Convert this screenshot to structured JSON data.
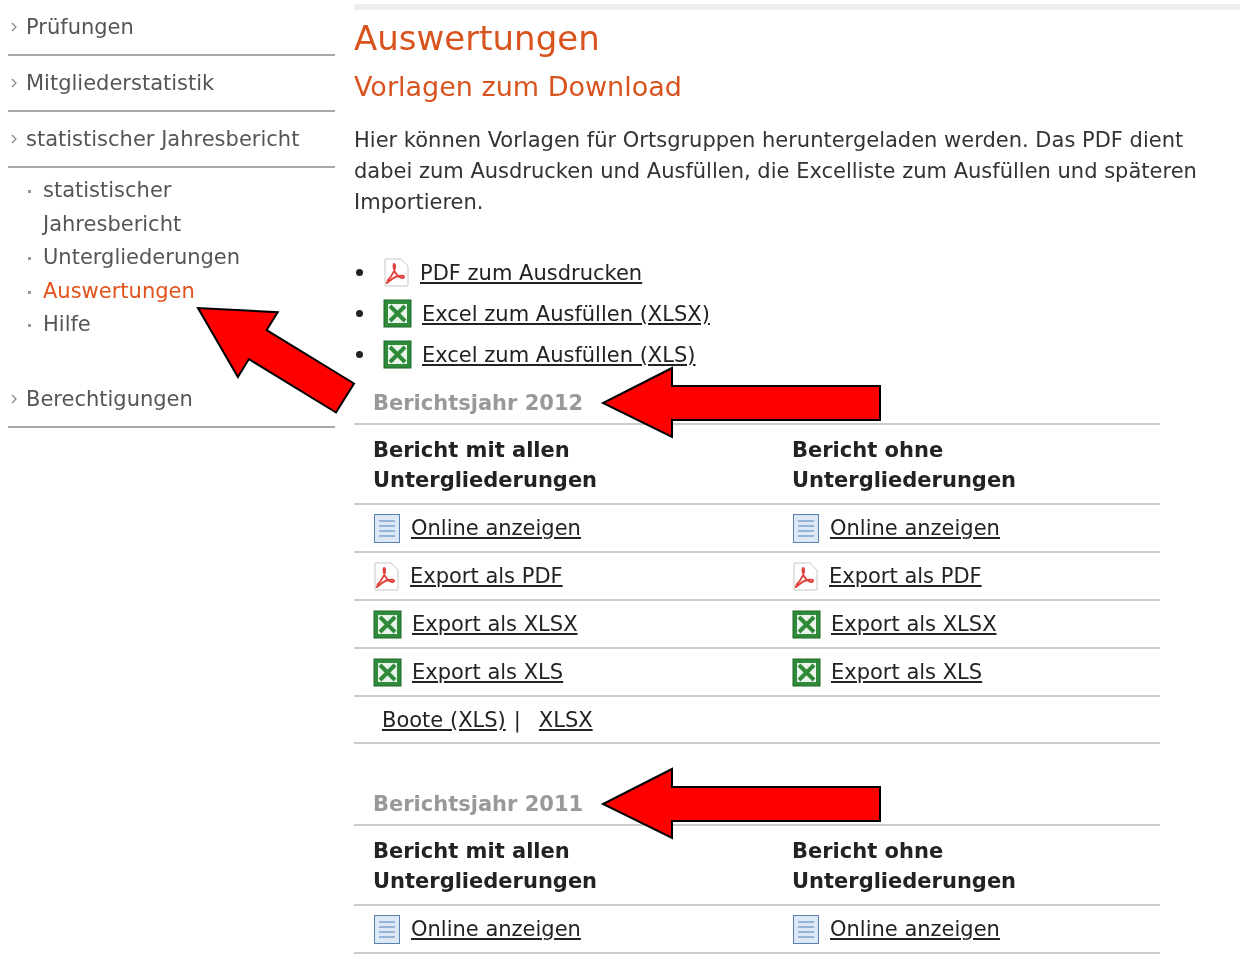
{
  "sidebar": {
    "items": [
      {
        "label": "Prüfungen"
      },
      {
        "label": "Mitgliederstatistik"
      },
      {
        "label": "statistischer Jahresbericht",
        "children": [
          {
            "label": "statistischer Jahresbericht",
            "selected": false
          },
          {
            "label": "Untergliederungen",
            "selected": false
          },
          {
            "label": "Auswertungen",
            "selected": true
          },
          {
            "label": "Hilfe",
            "selected": false
          }
        ]
      },
      {
        "label": "Berechtigungen"
      }
    ]
  },
  "main": {
    "title": "Auswertungen",
    "subtitle": "Vorlagen zum Download",
    "intro": "Hier können Vorlagen für Ortsgruppen heruntergeladen werden. Das PDF dient dabei zum Ausdrucken und Ausfüllen, die Excelliste zum Ausfüllen und späteren Importieren.",
    "downloads": [
      {
        "label": "PDF zum Ausdrucken",
        "kind": "pdf"
      },
      {
        "label": "Excel zum Ausfüllen (XLSX)",
        "kind": "excel"
      },
      {
        "label": "Excel zum Ausfüllen (XLS)",
        "kind": "excel"
      }
    ],
    "report_years": [
      {
        "title": "Berichtsjahr 2012",
        "columns": [
          "Bericht mit allen Untergliederungen",
          "Bericht ohne Untergliederungen"
        ],
        "rows": [
          [
            {
              "label": "Online anzeigen",
              "kind": "online"
            },
            {
              "label": "Online anzeigen",
              "kind": "online"
            }
          ],
          [
            {
              "label": "Export als PDF",
              "kind": "pdf"
            },
            {
              "label": "Export als PDF",
              "kind": "pdf"
            }
          ],
          [
            {
              "label": "Export als XLSX",
              "kind": "excel"
            },
            {
              "label": "Export als XLSX",
              "kind": "excel"
            }
          ],
          [
            {
              "label": "Export als XLS",
              "kind": "excel"
            },
            {
              "label": "Export als XLS",
              "kind": "excel"
            }
          ]
        ],
        "extra_links": {
          "links": [
            "Boote (XLS)",
            "XLSX"
          ],
          "separator": "|"
        }
      },
      {
        "title": "Berichtsjahr 2011",
        "columns": [
          "Bericht mit allen Untergliederungen",
          "Bericht ohne Untergliederungen"
        ],
        "rows": [
          [
            {
              "label": "Online anzeigen",
              "kind": "online"
            },
            {
              "label": "Online anzeigen",
              "kind": "online"
            }
          ]
        ]
      }
    ]
  }
}
